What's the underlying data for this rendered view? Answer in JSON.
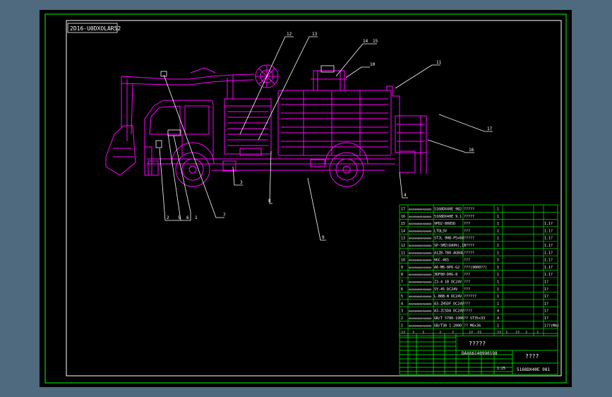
{
  "drawing": {
    "stamp_text": "2D16-U0DXOLAR52",
    "callouts": [
      "12",
      "13",
      "14",
      "15",
      "10",
      "11",
      "17",
      "16",
      "3",
      "8",
      "9",
      "4",
      "2",
      "5",
      "6",
      "1",
      "7"
    ],
    "title_cell": "?????",
    "drawing_number": "DAX66140990198",
    "name_cell": "????",
    "code_cell": "5168DX40E 981",
    "scale_text": "1:25"
  },
  "bom": {
    "rows": [
      {
        "no": "17",
        "code": "0A0A0A0A0A0A0A0",
        "spec": "5168DX40E 982",
        "name": "?????",
        "qty": "1",
        "note": ""
      },
      {
        "no": "16",
        "code": "0A0A0A0A0A0A0A0",
        "spec": "5168DX40E 9.1",
        "name": "?????",
        "qty": "1",
        "note": ""
      },
      {
        "no": "15",
        "code": "0A0A0A0A0A0A0A0",
        "spec": "9PD2-8085D",
        "name": "???",
        "qty": "1",
        "note": "1.1?"
      },
      {
        "no": "14",
        "code": "0A0A0A0A0A0A0A0",
        "spec": "LTQLSV",
        "name": "???",
        "qty": "1",
        "note": "1.1?"
      },
      {
        "no": "13",
        "code": "0A0A0A0A0A0A0A0",
        "spec": "STJL 9HB-P5x68",
        "name": "?????",
        "qty": "1",
        "note": "1.1?"
      },
      {
        "no": "12",
        "code": "0A0A0A0A0A0A0A0",
        "spec": "SP-SMZ(DA9%),15",
        "name": "?????",
        "qty": "1",
        "note": "1.1?"
      },
      {
        "no": "11",
        "code": "0A0A0A0A0A0A0A0",
        "spec": "A1ZB-7B0-AGB4L",
        "name": "?????",
        "qty": "1",
        "note": "1.1?"
      },
      {
        "no": "10",
        "code": "0A0A0A0A0A0A0A0",
        "spec": "HGC-465",
        "name": "???",
        "qty": "5",
        "note": "1.1?"
      },
      {
        "no": "9",
        "code": "0A0A0A0A0A0A0A0",
        "spec": "A6-M6-0P6-G2",
        "name": "???(9000??)",
        "qty": "1",
        "note": "1.1?"
      },
      {
        "no": "8",
        "code": "0A0A0A0A0A0A0A0",
        "spec": "3DF80-D0G-8",
        "name": "???",
        "qty": "1",
        "note": "1.1?"
      },
      {
        "no": "7",
        "code": "0A0A0A0A0A0A0A0",
        "spec": "Z3-4 1B DC24V",
        "name": "???",
        "qty": "1",
        "note": "1?"
      },
      {
        "no": "6",
        "code": "0A0A0A0A0A0A0A0",
        "spec": "SY-45 DC24V",
        "name": "???",
        "qty": "1",
        "note": "1?"
      },
      {
        "no": "5",
        "code": "0A0A0A0A0A0A0A0",
        "spec": "L-B6B-N DC24V",
        "name": "??????",
        "qty": "1",
        "note": "1?"
      },
      {
        "no": "4",
        "code": "0A0A0A0A0A0A0A0",
        "spec": "A3-ZH5DF DC24V",
        "name": "???",
        "qty": "1",
        "note": "1?"
      },
      {
        "no": "3",
        "code": "0A0A0A0A0A0A0A0",
        "spec": "A3-ZC5DA DC24V",
        "name": "????",
        "qty": "4",
        "note": "1?"
      },
      {
        "no": "2",
        "code": "0A0A0A0A0A0A0A0",
        "spec": "GB/T 5780-1986",
        "name": "?? ST35x33",
        "qty": "4",
        "note": "1?"
      },
      {
        "no": "1",
        "code": "0A0A0A0A0A0A0A0",
        "spec": "GB/T30 1-2000",
        "name": "?? M6x36",
        "qty": "1",
        "note": "1??(MA)"
      }
    ],
    "header": [
      "??",
      "?",
      "?",
      "?",
      "?",
      "??",
      "??",
      "??",
      "?",
      "??",
      "?",
      "?"
    ]
  },
  "colors": {
    "background": "#000000",
    "ui_frame": "#4f6a7e",
    "border": "#00ff00",
    "truck": "#ff00ff",
    "leaders": "#ffffff",
    "table": "#00ff00",
    "table_text": "#ffffff"
  }
}
